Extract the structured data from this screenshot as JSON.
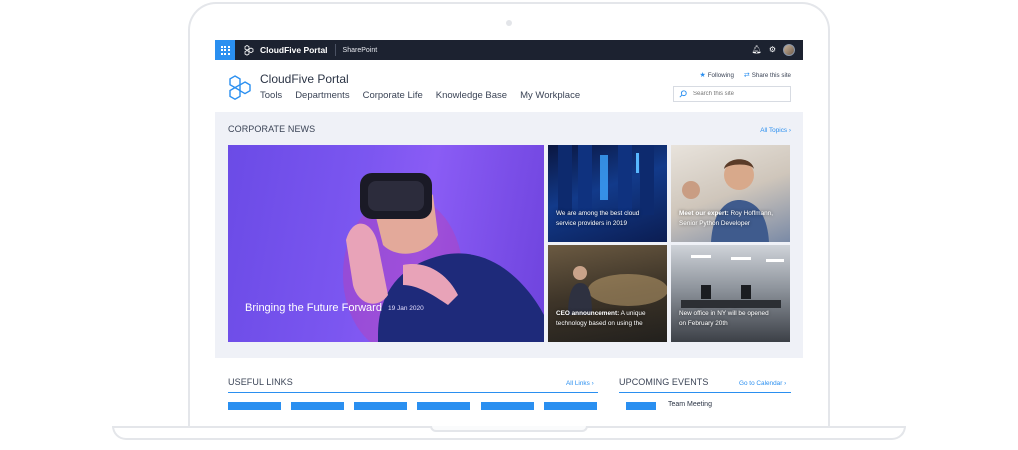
{
  "suitebar": {
    "title": "CloudFive Portal",
    "app": "SharePoint",
    "icons": [
      "waffle-icon",
      "bell-icon",
      "gear-icon",
      "avatar"
    ]
  },
  "site": {
    "title": "CloudFive Portal",
    "nav": [
      "Tools",
      "Departments",
      "Corporate Life",
      "Knowledge Base",
      "My Workplace"
    ],
    "actions": {
      "following": "Following",
      "share": "Share this site"
    },
    "search_placeholder": "Search this site"
  },
  "news": {
    "heading": "CORPORATE NEWS",
    "all_topics": "All Topics ›",
    "hero": {
      "title": "Bringing the Future Forward",
      "date": "19 Jan 2020"
    },
    "tiles": [
      {
        "bold": "",
        "text": "We are among the best cloud service providers in 2019"
      },
      {
        "bold": "Meet our expert:",
        "text": " Roy Hoffmann, Senior Python Developer"
      },
      {
        "bold": "CEO announcement:",
        "text": " A unique technology based on using the"
      },
      {
        "bold": "",
        "text": "New office in NY will be opened on February 20th"
      }
    ]
  },
  "links": {
    "heading": "USEFUL LINKS",
    "all_links": "All Links ›"
  },
  "events": {
    "heading": "UPCOMING EVENTS",
    "calendar": "Go to Calendar ›",
    "first_event": "Team Meeting"
  },
  "colors": {
    "accent": "#2a8ff0",
    "suitebar": "#1c2230",
    "hero": "#7b56f0"
  }
}
